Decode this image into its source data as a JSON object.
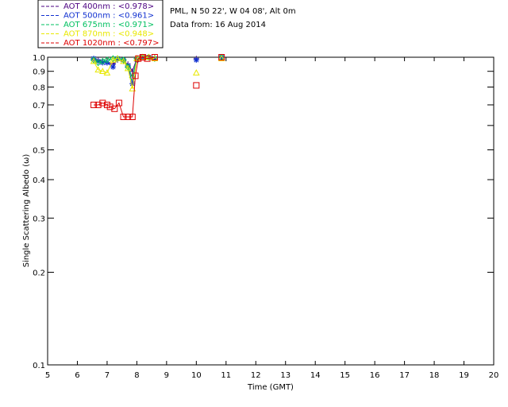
{
  "header": {
    "site": "PML, N 50 22', W 04 08', Alt 0m",
    "date": "Data from: 16 Aug 2014"
  },
  "chart_data": {
    "type": "scatter",
    "title": "",
    "xlabel": "Time (GMT)",
    "ylabel": "Single Scattering Albedo (ω)",
    "xlim": [
      5,
      20
    ],
    "ylim": [
      0.1,
      1.0
    ],
    "yscale": "log",
    "x_ticks": [
      "5",
      "6",
      "7",
      "8",
      "9",
      "10",
      "11",
      "12",
      "13",
      "14",
      "15",
      "16",
      "17",
      "18",
      "19",
      "20"
    ],
    "y_ticks": [
      "0.1",
      "0.2",
      "0.3",
      "0.4",
      "0.5",
      "0.6",
      "0.7",
      "0.8",
      "0.9",
      "1.0"
    ],
    "grid": false,
    "legend_position": "top-left outside",
    "series": [
      {
        "name": "AOT  400nm : <0.978>",
        "color": "#4b0082",
        "marker": "plus",
        "x": [
          6.55,
          6.7,
          6.85,
          7.0,
          7.2,
          7.35,
          7.55,
          7.7,
          7.85,
          8.0,
          8.2,
          8.4,
          8.6,
          10.0,
          10.85
        ],
        "y": [
          0.99,
          0.98,
          0.97,
          0.96,
          0.95,
          0.98,
          0.97,
          0.95,
          0.9,
          0.99,
          1.0,
          1.0,
          1.0,
          0.99,
          1.0
        ]
      },
      {
        "name": "AOT  500nm : <0.961>",
        "color": "#1030d0",
        "marker": "star",
        "x": [
          6.55,
          6.7,
          6.85,
          7.0,
          7.2,
          7.35,
          7.55,
          7.7,
          7.85,
          8.0,
          8.2,
          8.4,
          8.6,
          10.0,
          10.85
        ],
        "y": [
          0.99,
          0.97,
          0.96,
          0.96,
          0.93,
          0.99,
          0.98,
          0.94,
          0.82,
          0.98,
          1.0,
          1.0,
          0.99,
          0.98,
          1.0
        ]
      },
      {
        "name": "AOT  675nm : <0.971>",
        "color": "#00c060",
        "marker": "diamond",
        "x": [
          6.55,
          6.7,
          6.85,
          7.0,
          7.2,
          7.35,
          7.55,
          7.7,
          7.85,
          8.0,
          8.2,
          8.4,
          8.6,
          10.85
        ],
        "y": [
          0.98,
          0.96,
          0.97,
          0.98,
          0.99,
          0.99,
          0.98,
          0.93,
          0.86,
          0.99,
          1.0,
          1.0,
          0.99,
          1.0
        ]
      },
      {
        "name": "AOT  870nm : <0.948>",
        "color": "#e8e800",
        "marker": "triangle",
        "x": [
          6.55,
          6.7,
          6.85,
          7.0,
          7.2,
          7.35,
          7.55,
          7.7,
          7.85,
          8.0,
          8.2,
          8.4,
          8.6,
          10.0,
          10.85
        ],
        "y": [
          0.97,
          0.91,
          0.9,
          0.89,
          0.98,
          0.99,
          0.97,
          0.92,
          0.79,
          0.99,
          1.0,
          1.0,
          0.99,
          0.89,
          0.99
        ]
      },
      {
        "name": "AOT 1020nm : <0.797>",
        "color": "#dd0000",
        "marker": "square",
        "x": [
          6.55,
          6.7,
          6.85,
          7.0,
          7.1,
          7.25,
          7.4,
          7.55,
          7.7,
          7.85,
          7.95,
          8.05,
          8.2,
          8.35,
          8.6,
          10.0,
          10.85
        ],
        "y": [
          0.7,
          0.7,
          0.71,
          0.7,
          0.69,
          0.68,
          0.71,
          0.64,
          0.64,
          0.64,
          0.87,
          0.99,
          1.0,
          0.99,
          1.0,
          0.81,
          1.0
        ]
      }
    ]
  }
}
